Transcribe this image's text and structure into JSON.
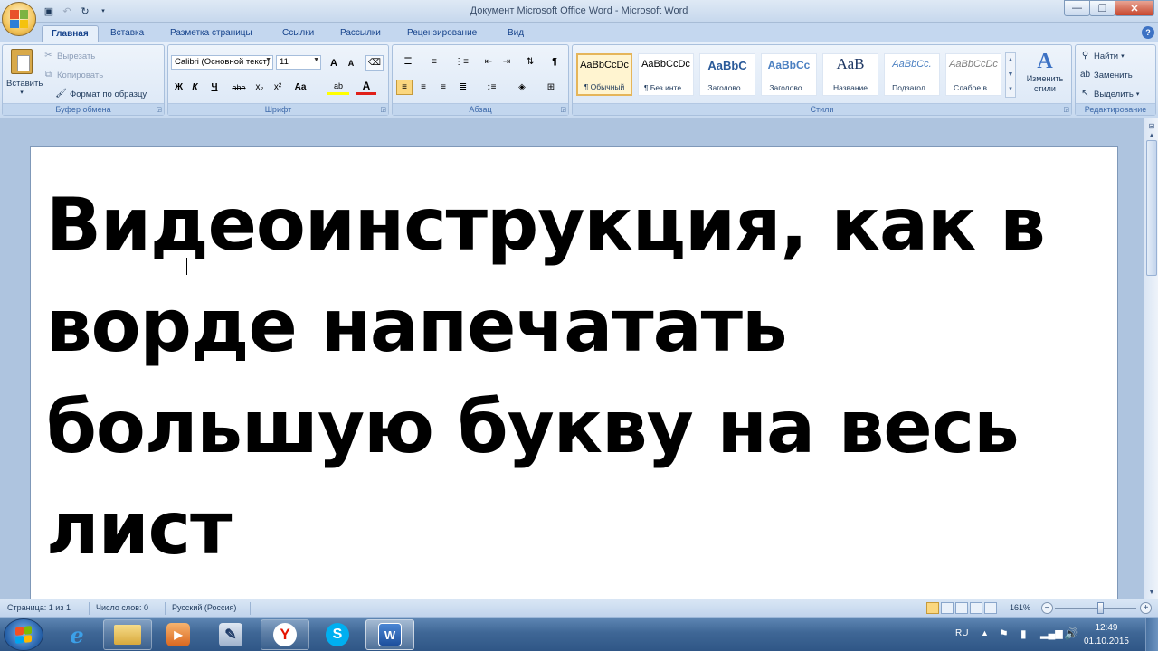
{
  "window": {
    "title": "Документ Microsoft Office Word - Microsoft Word",
    "minimize": "—",
    "maximize": "❐",
    "close": "✕"
  },
  "tabs": [
    "Главная",
    "Вставка",
    "Разметка страницы",
    "Ссылки",
    "Рассылки",
    "Рецензирование",
    "Вид"
  ],
  "ribbon": {
    "clipboard": {
      "label": "Буфер обмена",
      "paste": "Вставить",
      "cut": "Вырезать",
      "copy": "Копировать",
      "format_painter": "Формат по образцу"
    },
    "font": {
      "label": "Шрифт",
      "font_name": "Calibri (Основной текст)",
      "font_size": "11",
      "grow": "A",
      "shrink": "A",
      "bold": "Ж",
      "italic": "К",
      "underline": "Ч",
      "strike": "abe",
      "subscript": "x₂",
      "superscript": "x²",
      "change_case": "Aa",
      "highlight": "ab",
      "font_color": "A"
    },
    "paragraph": {
      "label": "Абзац"
    },
    "styles": {
      "label": "Стили",
      "items": [
        {
          "preview": "AaBbCcDc",
          "name": "¶ Обычный"
        },
        {
          "preview": "AaBbCcDc",
          "name": "¶ Без инте..."
        },
        {
          "preview": "AaBbC",
          "name": "Заголово..."
        },
        {
          "preview": "AaBbCc",
          "name": "Заголово..."
        },
        {
          "preview": "АаВ",
          "name": "Название"
        },
        {
          "preview": "AaBbCc.",
          "name": "Подзагол..."
        },
        {
          "preview": "AaBbCcDc",
          "name": "Слабое в..."
        }
      ],
      "change_styles": "Изменить стили"
    },
    "editing": {
      "label": "Редактирование",
      "find": "Найти",
      "replace": "Заменить",
      "select": "Выделить"
    }
  },
  "document": {
    "text": "Видеоинструкция, как в ворде напечатать большую букву на весь лист"
  },
  "statusbar": {
    "page": "Страница: 1 из 1",
    "words": "Число слов: 0",
    "language": "Русский (Россия)",
    "zoom": "161%"
  },
  "taskbar": {
    "lang": "RU",
    "time": "12:49",
    "date": "01.10.2015"
  }
}
